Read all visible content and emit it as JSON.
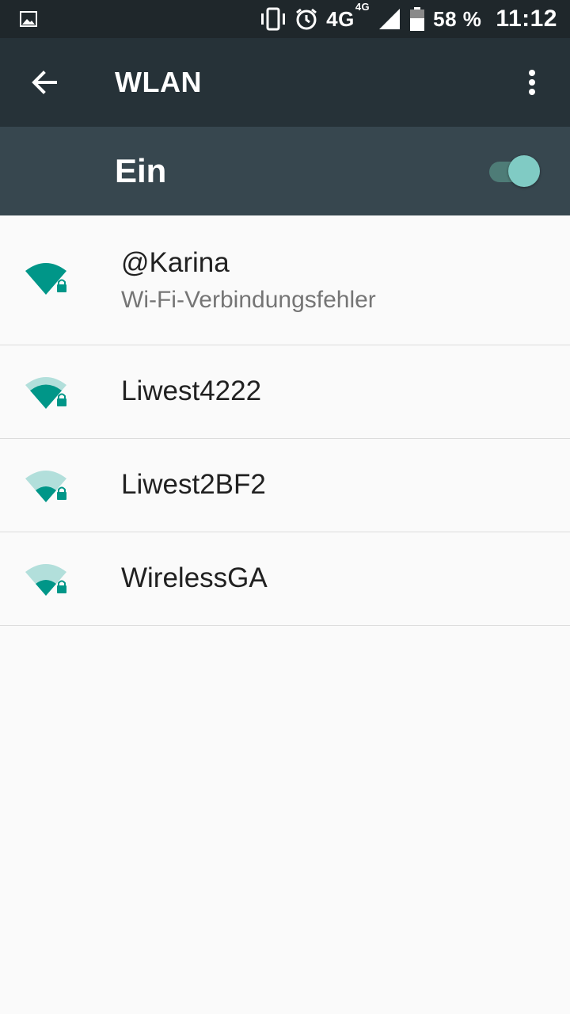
{
  "status_bar": {
    "network": "4G",
    "network_sub": "4G",
    "battery": "58 %",
    "time": "11:12",
    "icons": [
      "image-icon",
      "vibrate-icon",
      "alarm-icon",
      "signal-icon",
      "battery-icon"
    ]
  },
  "appbar": {
    "title": "WLAN",
    "back_icon": "arrow-back-icon",
    "menu_icon": "more-vert-icon"
  },
  "switch": {
    "label": "Ein",
    "on": true
  },
  "networks": [
    {
      "ssid": "@Karina",
      "status": "Wi-Fi-Verbindungsfehler",
      "signal": 4,
      "secured": true
    },
    {
      "ssid": "Liwest4222",
      "status": "",
      "signal": 3,
      "secured": true
    },
    {
      "ssid": "Liwest2BF2",
      "status": "",
      "signal": 2,
      "secured": true
    },
    {
      "ssid": "WirelessGA",
      "status": "",
      "signal": 2,
      "secured": true
    }
  ],
  "colors": {
    "status_bar": "#1f272b",
    "app_bar": "#263238",
    "switch_bar": "#37474f",
    "accent": "#009688",
    "accent_light": "#b2dfdb",
    "toggle_thumb": "#80cbc4"
  }
}
